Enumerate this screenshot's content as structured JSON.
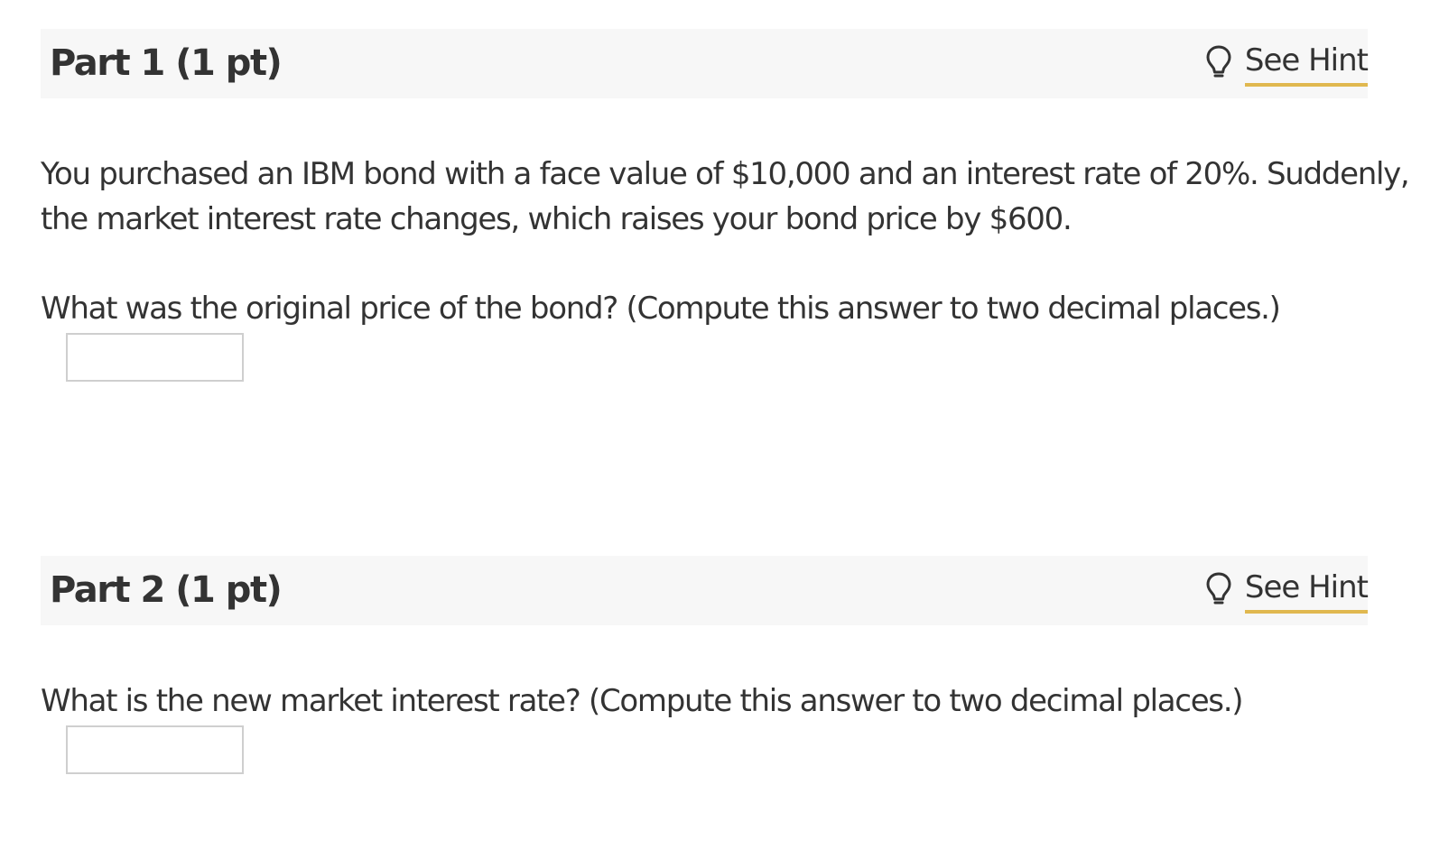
{
  "part1": {
    "title": "Part 1 (1 pt)",
    "hint_label": "See Hint",
    "hint_icon": "lightbulb-icon",
    "problem_line1": "You purchased an IBM bond with a face value of $10,000 and an interest rate of 20%. Suddenly,",
    "problem_line2": "the market interest rate changes, which raises your bond price by $600.",
    "question": "What was the original price of the bond? (Compute this answer to two decimal places.)",
    "answer_value": ""
  },
  "part2": {
    "title": "Part 2 (1 pt)",
    "hint_label": "See Hint",
    "hint_icon": "lightbulb-icon",
    "question": "What is the new market interest rate? (Compute this answer to two decimal places.)",
    "answer_value": ""
  },
  "colors": {
    "header_background": "#f7f7f7",
    "hint_underline": "#e0b84f",
    "text": "#333333",
    "input_border": "#cfcfcf"
  }
}
